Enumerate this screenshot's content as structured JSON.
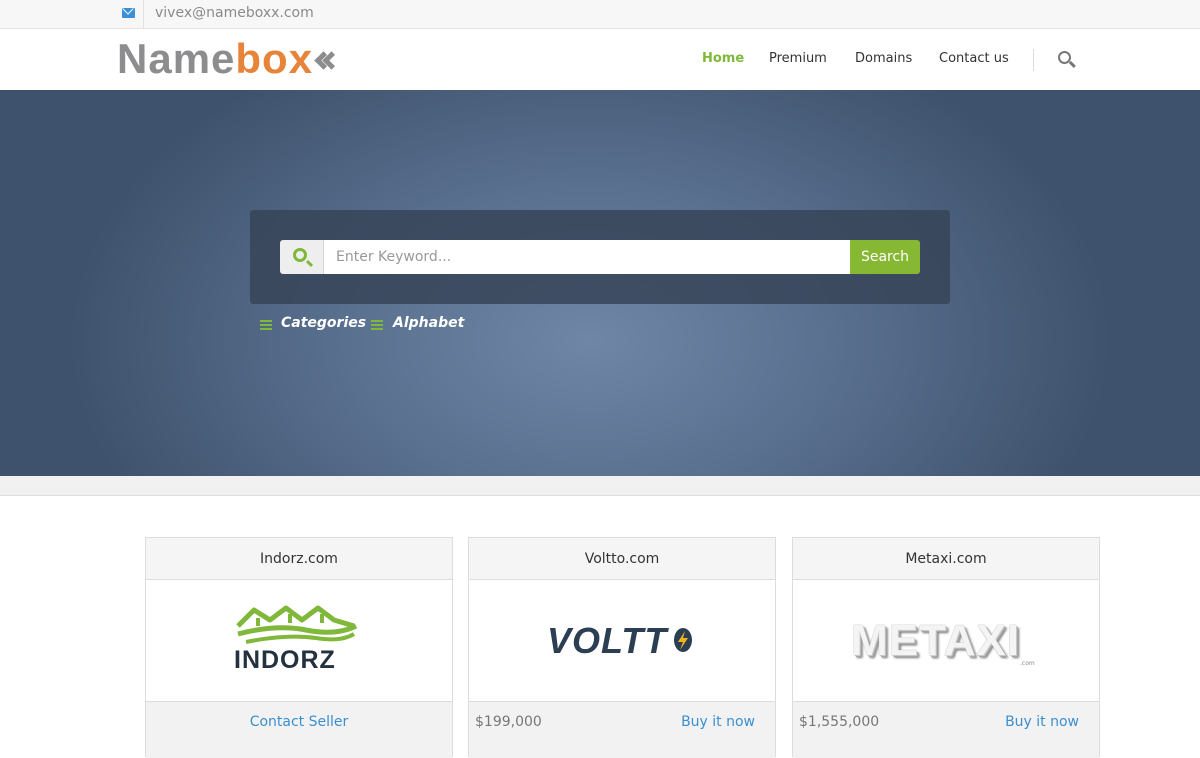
{
  "topbar": {
    "email": "vivex@nameboxx.com"
  },
  "header": {
    "logo_part1": "Name",
    "logo_part2": "box",
    "nav": [
      {
        "label": "Home",
        "active": true
      },
      {
        "label": "Premium"
      },
      {
        "label": "Domains"
      },
      {
        "label": "Contact us"
      }
    ]
  },
  "hero": {
    "search_placeholder": "Enter Keyword...",
    "search_button": "Search",
    "links": [
      "Categories",
      "Alphabet"
    ]
  },
  "domains": [
    {
      "name": "Indorz.com",
      "logo_text": "INDORZ",
      "price": "",
      "action": "Contact Seller"
    },
    {
      "name": "Voltto.com",
      "logo_text": "VOLTT",
      "price": "$199,000",
      "action": "Buy it now"
    },
    {
      "name": "Metaxi.com",
      "logo_text": "METAXI",
      "logo_subtext": ".com",
      "price": "$1,555,000",
      "action": "Buy it now"
    }
  ],
  "colors": {
    "accent_green": "#86b833",
    "logo_orange": "#e8843a",
    "link_blue": "#3a8fd0"
  },
  "icons": [
    "envelope-icon",
    "search-icon",
    "menu-icon",
    "lightning-bolt-icon"
  ]
}
